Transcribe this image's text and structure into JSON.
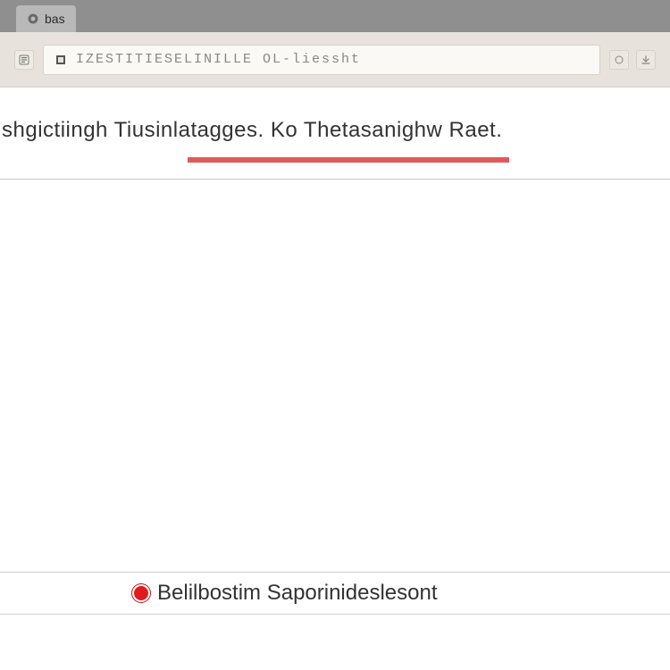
{
  "tab": {
    "title": "bas"
  },
  "address": {
    "url_text": "IZESTITIESELINILLE OL-liessht"
  },
  "page": {
    "heading": "shgictiingh Tiusinlatagges. Ko Thetasanighw Raet."
  },
  "status": {
    "label": "Belilbostim Saporinideslesont"
  }
}
